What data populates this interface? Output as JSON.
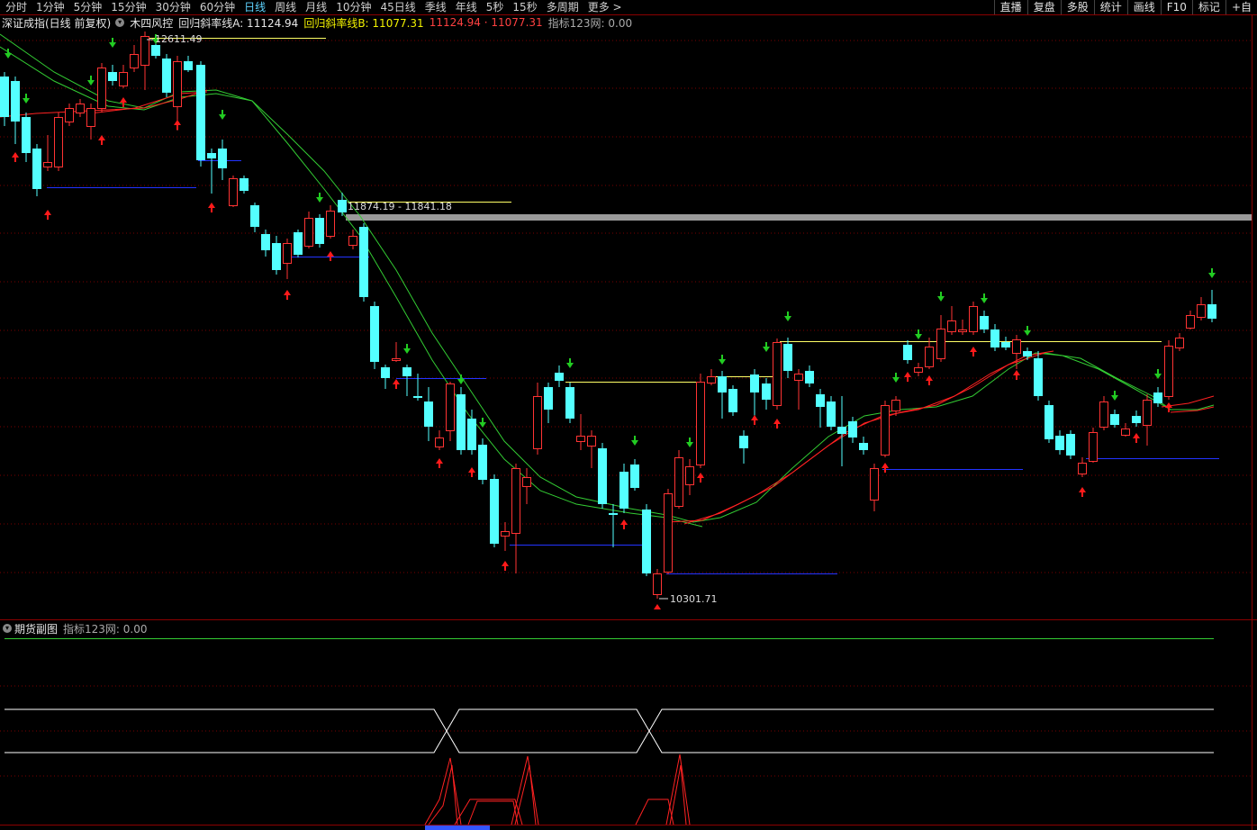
{
  "toolbar": {
    "periods": [
      "分时",
      "1分钟",
      "5分钟",
      "15分钟",
      "30分钟",
      "60分钟",
      "日线",
      "周线",
      "月线",
      "10分钟",
      "45日线",
      "季线",
      "年线",
      "5秒",
      "15秒",
      "多周期",
      "更多 >"
    ],
    "active_period": "日线",
    "right_buttons": [
      "直播",
      "复盘",
      "多股",
      "统计",
      "画线",
      "F10",
      "标记",
      "+自"
    ]
  },
  "main_chart": {
    "title": "深证成指(日线 前复权)",
    "indicator_name": "木四风控",
    "line_a_label": "回归斜率线A: 11124.94",
    "line_b_label": "回归斜率线B: 11077.31",
    "extra_values": "11124.94 · 11077.31",
    "indicator_value": "指标123网: 0.00",
    "annotations": {
      "high": "12611.49",
      "band": "11874.19 - 11841.18",
      "low": "10301.71"
    },
    "colors": {
      "up": "#ff3333",
      "down": "#54ffff",
      "ma_green": "#33cc33",
      "ma_red": "#ff2222",
      "support": "#2233ff",
      "resist": "#ffff66",
      "band": "#9a9a9a"
    }
  },
  "sub_chart": {
    "title": "期货副图",
    "indicator_value": "指标123网: 0.00"
  }
}
